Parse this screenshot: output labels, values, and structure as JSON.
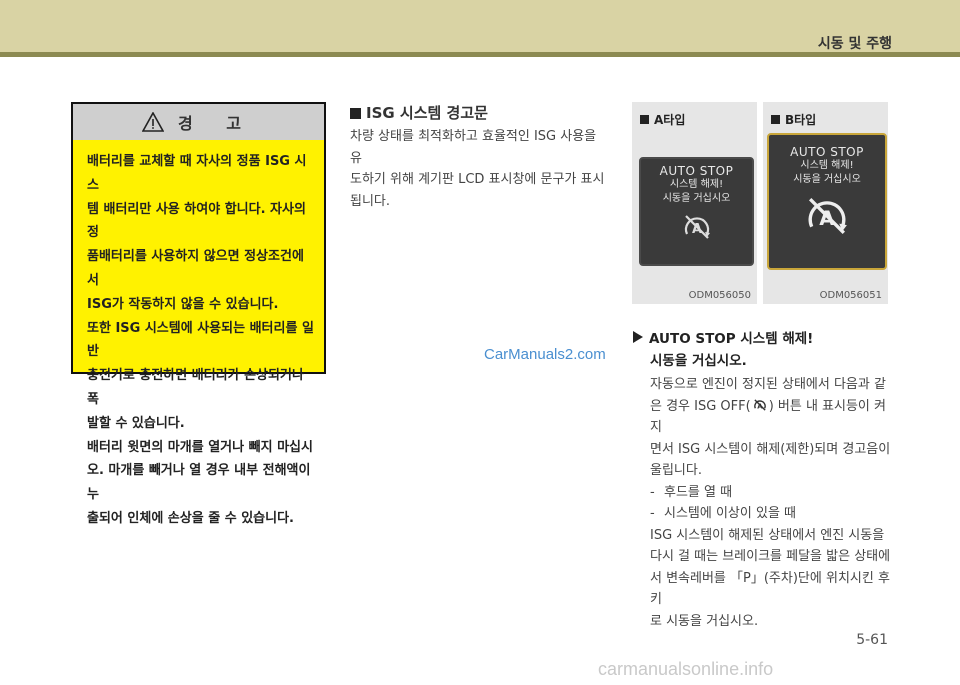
{
  "header": {
    "section_title": "시동 및 주행"
  },
  "warning": {
    "title": "경 고",
    "lines": [
      "배터리를 교체할 때 자사의 정품 ISG 시스",
      "템 배터리만 사용 하여야 합니다. 자사의 정",
      "품배터리를 사용하지 않으면 정상조건에서",
      "ISG가 작동하지 않을 수 있습니다.",
      "또한 ISG 시스템에 사용되는 배터리를 일반",
      "충전기로 충전하면 배터리가 손상되거나 폭",
      "발할 수 있습니다.",
      "배터리 윗면의 마개를 열거나 빼지 마십시",
      "오. 마개를 빼거나 열 경우 내부 전해액이 누",
      "출되어 인체에 손상을 줄 수 있습니다."
    ]
  },
  "isg": {
    "title": "ISG 시스템 경고문",
    "lines": [
      "차량 상태를 최적화하고 효율적인 ISG 사용을 유",
      "도하기 위해 계기판 LCD 표시창에 문구가 표시",
      "됩니다."
    ]
  },
  "watermark": "CarManuals2.com",
  "panels": [
    {
      "label": "A타입",
      "screen_title": "AUTO STOP",
      "line1": "시스템 해제!",
      "line2": "시동을 거십시오",
      "code": "ODM056050"
    },
    {
      "label": "B타입",
      "screen_title": "AUTO STOP",
      "line1": "시스템 해제!",
      "line2": "시동을 거십시오",
      "code": "ODM056051"
    }
  ],
  "auto_stop": {
    "heading": "AUTO STOP 시스템 해제!",
    "subheading": "시동을 거십시오.",
    "para1": [
      "자동으로 엔진이 정지된 상태에서 다음과 같",
      "은 경우 ISG OFF(",
      ") 버튼 내 표시등이 켜지",
      "면서 ISG 시스템이 해제(제한)되며 경고음이",
      "울립니다."
    ],
    "items": [
      "후드를 열 때",
      "시스템에 이상이 있을 때"
    ],
    "para2": [
      "ISG 시스템이 해제된 상태에서 엔진 시동을",
      "다시 걸 때는 브레이크를 페달을 밟은 상태에",
      "서 변속레버를 「P」(주차)단에 위치시킨 후 키",
      "로 시동을 거십시오."
    ],
    "icon_label": "A"
  },
  "page_number": "5-61",
  "footer": "carmanualsonline.info",
  "colors": {
    "warning_bg": "#fff200",
    "top_band": "#d9d3a4",
    "top_rule": "#8c8a52",
    "accent_gold": "#c9a63a"
  }
}
